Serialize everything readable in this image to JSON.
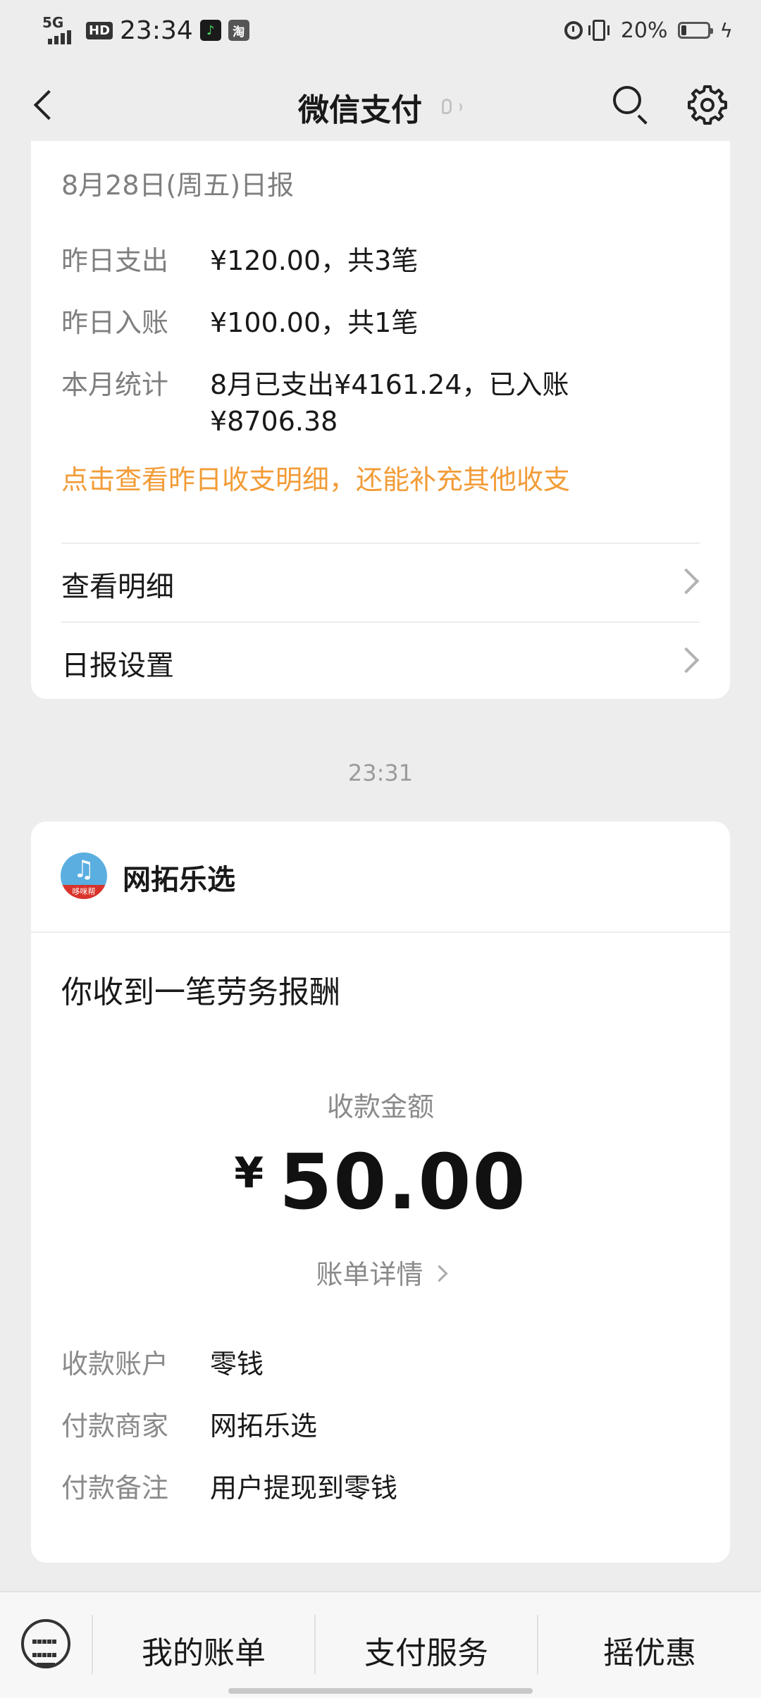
{
  "status_bar": {
    "network": "5G",
    "hd": "HD",
    "time": "23:34",
    "taobao_icon_text": "淘",
    "battery_percent_text": "20%",
    "battery_level": 0.2
  },
  "nav": {
    "title": "微信支付"
  },
  "daily_report": {
    "date": "8月28日(周五)日报",
    "rows": [
      {
        "label": "昨日支出",
        "value": "¥120.00，共3笔"
      },
      {
        "label": "昨日入账",
        "value": "¥100.00，共1笔"
      },
      {
        "label": "本月统计",
        "value": "8月已支出¥4161.24，已入账¥8706.38"
      }
    ],
    "hint": "点击查看昨日收支明细，还能补充其他收支",
    "menu": [
      {
        "label": "查看明细"
      },
      {
        "label": "日报设置"
      }
    ]
  },
  "timestamp": "23:31",
  "payment": {
    "merchant_name": "网拓乐选",
    "logo_text": "哆咪帮",
    "notice_title": "你收到一笔劳务报酬",
    "amount_label": "收款金额",
    "currency": "¥",
    "amount": "50.00",
    "bill_detail_link": "账单详情",
    "details": [
      {
        "label": "收款账户",
        "value": "零钱"
      },
      {
        "label": "付款商家",
        "value": "网拓乐选"
      },
      {
        "label": "付款备注",
        "value": "用户提现到零钱"
      }
    ]
  },
  "bottom_tabs": [
    {
      "label": "我的账单"
    },
    {
      "label": "支付服务"
    },
    {
      "label": "摇优惠"
    }
  ],
  "colors": {
    "accent_orange": "#f29c38",
    "background": "#ededed"
  }
}
